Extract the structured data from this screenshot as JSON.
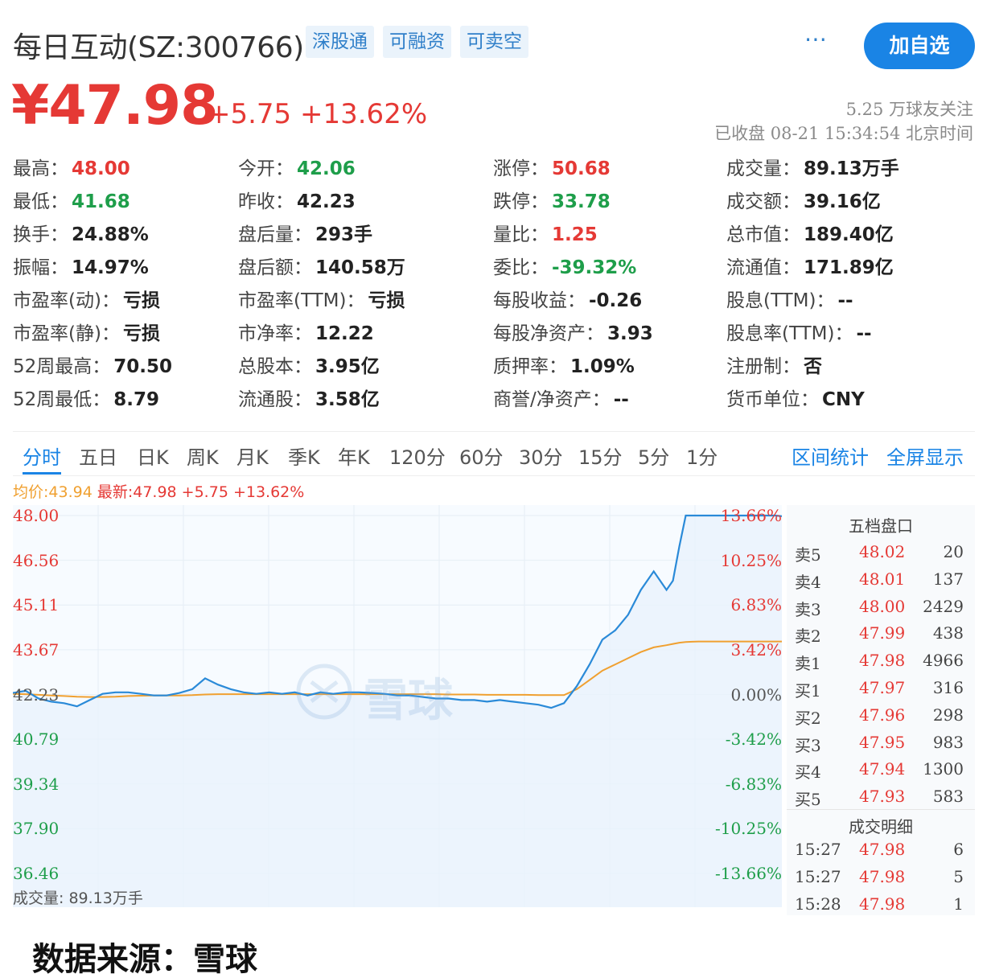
{
  "header": {
    "stock_name": "每日互动(SZ:300766)",
    "badges": [
      "深股通",
      "可融资",
      "可卖空"
    ],
    "more_icon": "⋯",
    "follow_button": "加自选",
    "price": "¥47.98",
    "change": "+5.75 +13.62%",
    "followers": "5.25 万球友关注",
    "market_status": "已收盘 08-21 15:34:54 北京时间"
  },
  "quote": [
    {
      "label": "最高：",
      "value": "48.00",
      "color": "red"
    },
    {
      "label": "今开：",
      "value": "42.06",
      "color": "green"
    },
    {
      "label": "涨停：",
      "value": "50.68",
      "color": "red"
    },
    {
      "label": "成交量：",
      "value": "89.13万手",
      "color": ""
    },
    {
      "label": "最低：",
      "value": "41.68",
      "color": "green"
    },
    {
      "label": "昨收：",
      "value": "42.23",
      "color": ""
    },
    {
      "label": "跌停：",
      "value": "33.78",
      "color": "green"
    },
    {
      "label": "成交额：",
      "value": "39.16亿",
      "color": ""
    },
    {
      "label": "换手：",
      "value": "24.88%",
      "color": ""
    },
    {
      "label": "盘后量：",
      "value": "293手",
      "color": ""
    },
    {
      "label": "量比：",
      "value": "1.25",
      "color": "red"
    },
    {
      "label": "总市值：",
      "value": "189.40亿",
      "color": ""
    },
    {
      "label": "振幅：",
      "value": "14.97%",
      "color": ""
    },
    {
      "label": "盘后额：",
      "value": "140.58万",
      "color": ""
    },
    {
      "label": "委比：",
      "value": "-39.32%",
      "color": "green"
    },
    {
      "label": "流通值：",
      "value": "171.89亿",
      "color": ""
    },
    {
      "label": "市盈率(动)：",
      "value": "亏损",
      "color": ""
    },
    {
      "label": "市盈率(TTM)：",
      "value": "亏损",
      "color": ""
    },
    {
      "label": "每股收益：",
      "value": "-0.26",
      "color": ""
    },
    {
      "label": "股息(TTM)：",
      "value": "--",
      "color": ""
    },
    {
      "label": "市盈率(静)：",
      "value": "亏损",
      "color": ""
    },
    {
      "label": "市净率：",
      "value": "12.22",
      "color": ""
    },
    {
      "label": "每股净资产：",
      "value": "3.93",
      "color": ""
    },
    {
      "label": "股息率(TTM)：",
      "value": "--",
      "color": ""
    },
    {
      "label": "52周最高：",
      "value": "70.50",
      "color": ""
    },
    {
      "label": "总股本：",
      "value": "3.95亿",
      "color": ""
    },
    {
      "label": "质押率：",
      "value": "1.09%",
      "color": ""
    },
    {
      "label": "注册制：",
      "value": "否",
      "color": ""
    },
    {
      "label": "52周最低：",
      "value": "8.79",
      "color": ""
    },
    {
      "label": "流通股：",
      "value": "3.58亿",
      "color": ""
    },
    {
      "label": "商誉/净资产：",
      "value": "--",
      "color": ""
    },
    {
      "label": "货币单位：",
      "value": "CNY",
      "color": ""
    }
  ],
  "tabs": [
    "分时",
    "五日",
    "日K",
    "周K",
    "月K",
    "季K",
    "年K",
    "120分",
    "60分",
    "30分",
    "15分",
    "5分",
    "1分"
  ],
  "active_tab": "分时",
  "tab_actions": [
    "区间统计",
    "全屏显示"
  ],
  "legend": {
    "avg": "均价:43.94",
    "latest": "最新:47.98 +5.75 +13.62%"
  },
  "volume_label": "成交量: 89.13万手",
  "watermark": "雪球",
  "orderbook": {
    "title": "五档盘口",
    "asks": [
      {
        "label": "卖5",
        "price": "48.02",
        "vol": "20"
      },
      {
        "label": "卖4",
        "price": "48.01",
        "vol": "137"
      },
      {
        "label": "卖3",
        "price": "48.00",
        "vol": "2429"
      },
      {
        "label": "卖2",
        "price": "47.99",
        "vol": "438"
      },
      {
        "label": "卖1",
        "price": "47.98",
        "vol": "4966"
      }
    ],
    "bids": [
      {
        "label": "买1",
        "price": "47.97",
        "vol": "316"
      },
      {
        "label": "买2",
        "price": "47.96",
        "vol": "298"
      },
      {
        "label": "买3",
        "price": "47.95",
        "vol": "983"
      },
      {
        "label": "买4",
        "price": "47.94",
        "vol": "1300"
      },
      {
        "label": "买5",
        "price": "47.93",
        "vol": "583"
      }
    ],
    "trades_title": "成交明细",
    "trades": [
      {
        "time": "15:27",
        "price": "47.98",
        "vol": "6"
      },
      {
        "time": "15:27",
        "price": "47.98",
        "vol": "5"
      },
      {
        "time": "15:28",
        "price": "47.98",
        "vol": "1"
      }
    ]
  },
  "source": "数据来源：雪球",
  "colors": {
    "up": "#e53935",
    "down": "#1e9e4a",
    "accent": "#1a84e5",
    "avg_line": "#f0a030",
    "price_line": "#2a8ad8"
  },
  "chart_data": {
    "type": "line",
    "title": "",
    "prev_close": 42.23,
    "ylim": [
      36.46,
      48.0
    ],
    "y_ticks_left": [
      "48.00",
      "46.56",
      "45.11",
      "43.67",
      "42.23",
      "40.79",
      "39.34",
      "37.90",
      "36.46"
    ],
    "y_ticks_right": [
      "13.66%",
      "10.25%",
      "6.83%",
      "3.42%",
      "0.00%",
      "-3.42%",
      "-6.83%",
      "-10.25%",
      "-13.66%"
    ],
    "x_minutes": [
      0,
      4,
      8,
      12,
      16,
      20,
      24,
      28,
      32,
      36,
      40,
      44,
      48,
      52,
      56,
      60,
      64,
      68,
      72,
      76,
      80,
      84,
      88,
      92,
      96,
      100,
      104,
      108,
      112,
      116,
      120,
      124,
      128,
      132,
      136,
      140,
      144,
      148,
      152,
      156,
      160,
      164,
      168,
      172,
      176,
      180,
      184,
      188,
      192,
      196,
      200,
      204,
      206,
      208,
      210,
      212,
      214,
      216,
      218,
      220,
      222,
      224,
      226,
      228,
      230,
      232,
      234,
      236,
      238,
      240
    ],
    "series": [
      {
        "name": "最新",
        "values": [
          42.28,
          42.35,
          42.1,
          42.0,
          41.95,
          41.85,
          42.05,
          42.25,
          42.3,
          42.3,
          42.25,
          42.2,
          42.2,
          42.28,
          42.4,
          42.75,
          42.55,
          42.4,
          42.3,
          42.25,
          42.3,
          42.25,
          42.3,
          42.2,
          42.3,
          42.25,
          42.3,
          42.3,
          42.28,
          42.25,
          42.2,
          42.2,
          42.15,
          42.1,
          42.1,
          42.05,
          42.05,
          42.0,
          42.05,
          42.0,
          41.95,
          41.9,
          41.8,
          41.95,
          42.5,
          43.2,
          44.0,
          44.3,
          44.8,
          45.6,
          46.2,
          45.6,
          45.9,
          47.0,
          48.0,
          48.0,
          48.0,
          48.0,
          48.0,
          48.0,
          48.0,
          48.0,
          48.0,
          48.0,
          48.0,
          48.0,
          48.0,
          48.0,
          48.0,
          47.98
        ]
      },
      {
        "name": "均价",
        "values": [
          42.25,
          42.24,
          42.22,
          42.2,
          42.18,
          42.16,
          42.15,
          42.15,
          42.16,
          42.18,
          42.19,
          42.2,
          42.2,
          42.2,
          42.21,
          42.23,
          42.24,
          42.24,
          42.24,
          42.24,
          42.24,
          42.24,
          42.24,
          42.24,
          42.24,
          42.24,
          42.24,
          42.24,
          42.24,
          42.24,
          42.24,
          42.24,
          42.24,
          42.24,
          42.23,
          42.23,
          42.23,
          42.22,
          42.22,
          42.22,
          42.22,
          42.21,
          42.21,
          42.21,
          42.4,
          42.7,
          43.0,
          43.2,
          43.4,
          43.6,
          43.75,
          43.82,
          43.86,
          43.9,
          43.92,
          43.93,
          43.94,
          43.94,
          43.94,
          43.94,
          43.94,
          43.94,
          43.94,
          43.94,
          43.94,
          43.94,
          43.94,
          43.94,
          43.94,
          43.94
        ]
      }
    ],
    "volume_total": "89.13万手"
  }
}
